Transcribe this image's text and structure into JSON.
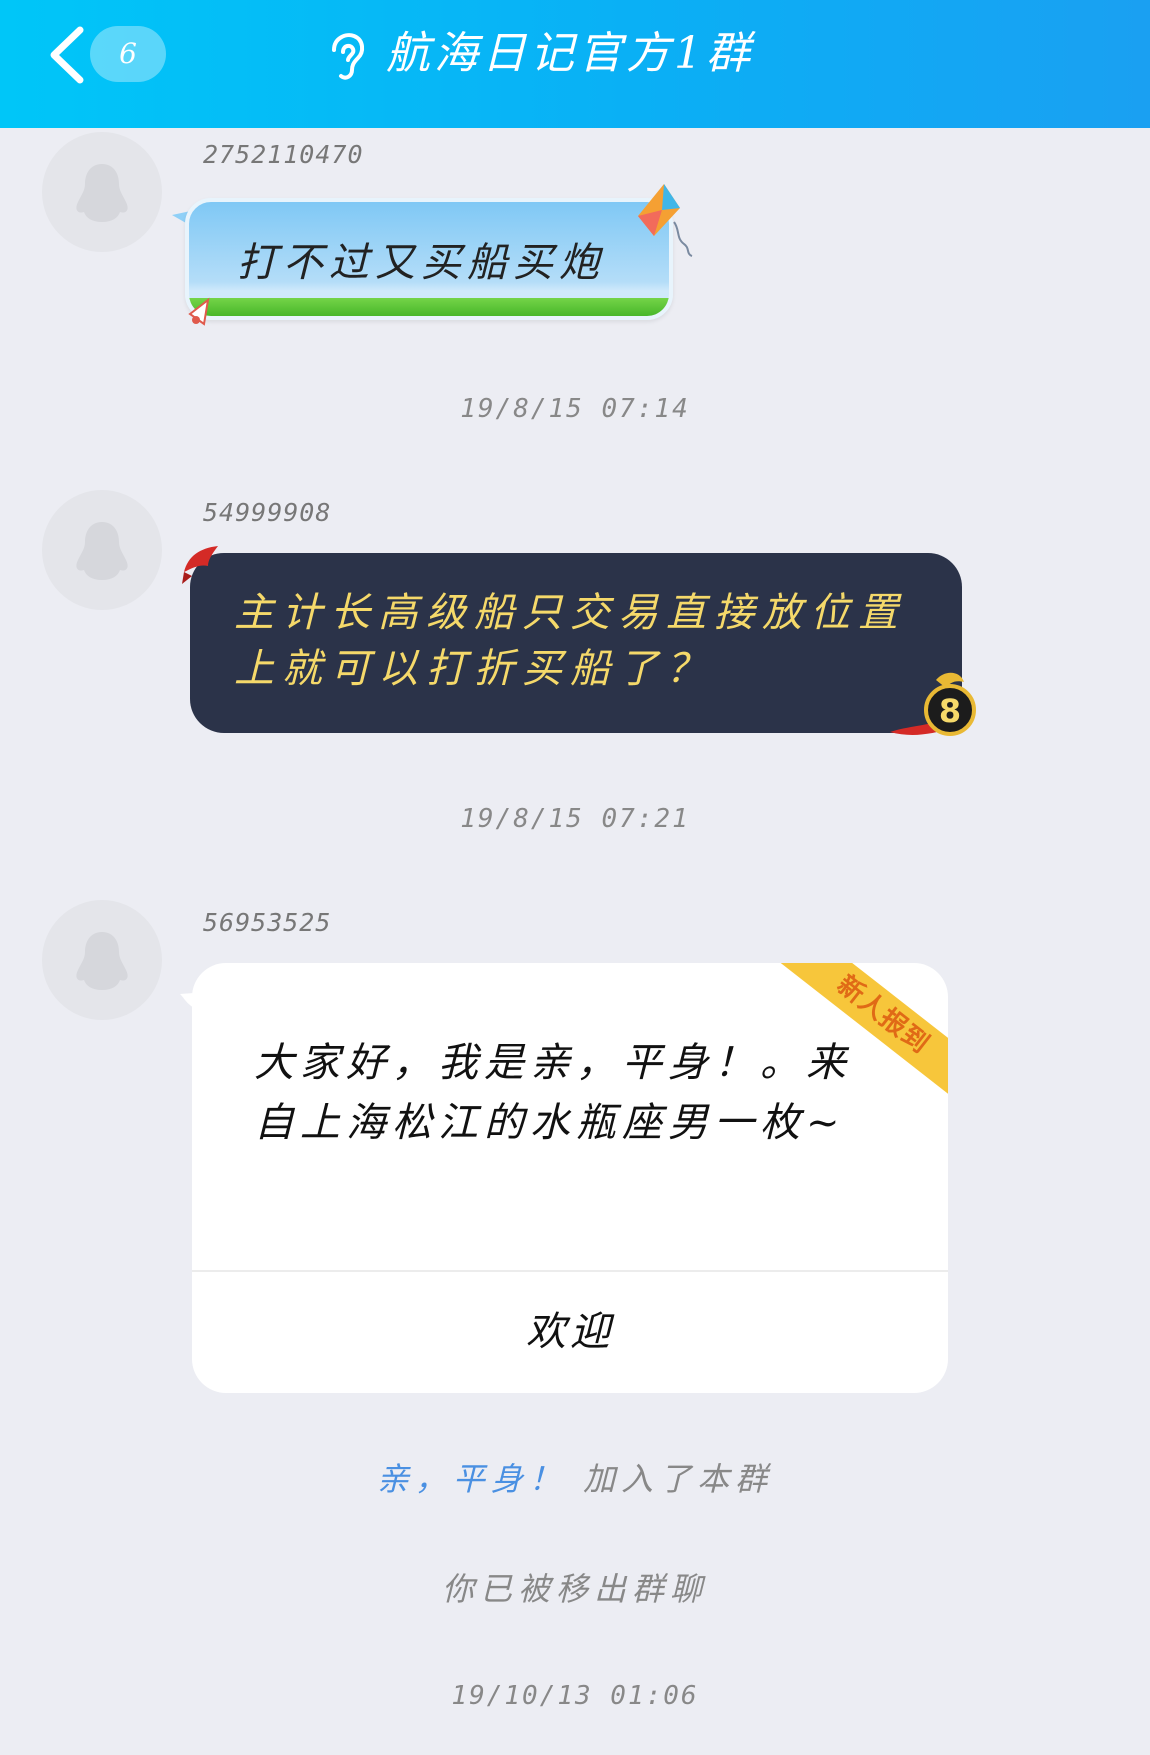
{
  "header": {
    "unread_count": "6",
    "title": "航海日记官方1群"
  },
  "messages": [
    {
      "sender": "2752110470",
      "text": "打不过又买船买炮",
      "bubble_style": "kite-sky"
    },
    {
      "timestamp": "19/8/15 07:14"
    },
    {
      "sender": "54999908",
      "text": "主计长高级船只交易直接放位置上就可以打折买船了？",
      "bubble_style": "dark-gold"
    },
    {
      "timestamp": "19/8/15 07:21"
    },
    {
      "sender": "56953525",
      "card": {
        "ribbon": "新人报到",
        "text": "大家好，我是亲，平身！。来自上海松江的水瓶座男一枚~",
        "button": "欢迎"
      }
    }
  ],
  "system": {
    "joined_name": "亲，平身！",
    "joined_rest": "加入了本群",
    "removed": "你已被移出群聊",
    "last_timestamp": "19/10/13 01:06"
  },
  "colors": {
    "header_start": "#00c6f8",
    "header_end": "#1aa0f2",
    "background": "#ecedf3",
    "dark_bubble": "#2b3349",
    "gold_text": "#f5d96a",
    "link_blue": "#4a90e2",
    "ribbon_yellow": "#f7c63b"
  },
  "icons": [
    "back-chevron-icon",
    "ear-icon",
    "penguin-avatar-icon",
    "kite-icon",
    "badge-8-icon"
  ]
}
